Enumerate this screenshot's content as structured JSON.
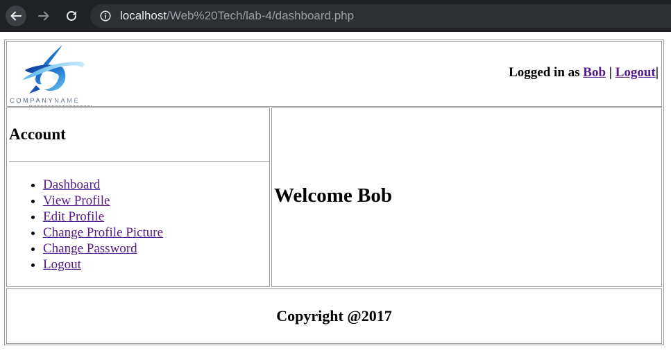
{
  "browser": {
    "url_host": "localhost",
    "url_path": "/Web%20Tech/lab-4/dashboard.php"
  },
  "header": {
    "logo_text_bold": "COMPANY",
    "logo_text_light": "NAME",
    "logged_in_prefix": "Logged in as",
    "username": "Bob",
    "separator": "|",
    "logout_label": "Logout",
    "trailing": "|"
  },
  "sidebar": {
    "title": "Account",
    "items": [
      {
        "label": "Dashboard"
      },
      {
        "label": "View Profile"
      },
      {
        "label": "Edit Profile"
      },
      {
        "label": "Change Profile Picture"
      },
      {
        "label": "Change Password"
      },
      {
        "label": "Logout"
      }
    ]
  },
  "main": {
    "welcome": "Welcome Bob"
  },
  "footer": {
    "copyright": "Copyright @2017"
  },
  "colors": {
    "link_visited": "#551a8b",
    "chrome_bg": "#202124",
    "border": "#9a9a9a"
  }
}
